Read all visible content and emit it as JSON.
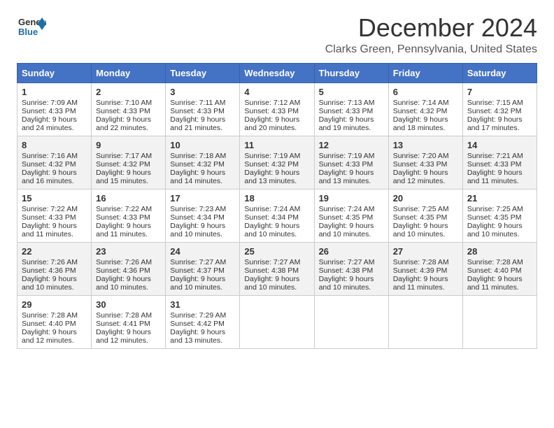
{
  "logo": {
    "general": "General",
    "blue": "Blue"
  },
  "title": "December 2024",
  "location": "Clarks Green, Pennsylvania, United States",
  "days_header": [
    "Sunday",
    "Monday",
    "Tuesday",
    "Wednesday",
    "Thursday",
    "Friday",
    "Saturday"
  ],
  "weeks": [
    [
      {
        "day": "1",
        "sunrise": "Sunrise: 7:09 AM",
        "sunset": "Sunset: 4:33 PM",
        "daylight": "Daylight: 9 hours and 24 minutes."
      },
      {
        "day": "2",
        "sunrise": "Sunrise: 7:10 AM",
        "sunset": "Sunset: 4:33 PM",
        "daylight": "Daylight: 9 hours and 22 minutes."
      },
      {
        "day": "3",
        "sunrise": "Sunrise: 7:11 AM",
        "sunset": "Sunset: 4:33 PM",
        "daylight": "Daylight: 9 hours and 21 minutes."
      },
      {
        "day": "4",
        "sunrise": "Sunrise: 7:12 AM",
        "sunset": "Sunset: 4:33 PM",
        "daylight": "Daylight: 9 hours and 20 minutes."
      },
      {
        "day": "5",
        "sunrise": "Sunrise: 7:13 AM",
        "sunset": "Sunset: 4:33 PM",
        "daylight": "Daylight: 9 hours and 19 minutes."
      },
      {
        "day": "6",
        "sunrise": "Sunrise: 7:14 AM",
        "sunset": "Sunset: 4:32 PM",
        "daylight": "Daylight: 9 hours and 18 minutes."
      },
      {
        "day": "7",
        "sunrise": "Sunrise: 7:15 AM",
        "sunset": "Sunset: 4:32 PM",
        "daylight": "Daylight: 9 hours and 17 minutes."
      }
    ],
    [
      {
        "day": "8",
        "sunrise": "Sunrise: 7:16 AM",
        "sunset": "Sunset: 4:32 PM",
        "daylight": "Daylight: 9 hours and 16 minutes."
      },
      {
        "day": "9",
        "sunrise": "Sunrise: 7:17 AM",
        "sunset": "Sunset: 4:32 PM",
        "daylight": "Daylight: 9 hours and 15 minutes."
      },
      {
        "day": "10",
        "sunrise": "Sunrise: 7:18 AM",
        "sunset": "Sunset: 4:32 PM",
        "daylight": "Daylight: 9 hours and 14 minutes."
      },
      {
        "day": "11",
        "sunrise": "Sunrise: 7:19 AM",
        "sunset": "Sunset: 4:32 PM",
        "daylight": "Daylight: 9 hours and 13 minutes."
      },
      {
        "day": "12",
        "sunrise": "Sunrise: 7:19 AM",
        "sunset": "Sunset: 4:33 PM",
        "daylight": "Daylight: 9 hours and 13 minutes."
      },
      {
        "day": "13",
        "sunrise": "Sunrise: 7:20 AM",
        "sunset": "Sunset: 4:33 PM",
        "daylight": "Daylight: 9 hours and 12 minutes."
      },
      {
        "day": "14",
        "sunrise": "Sunrise: 7:21 AM",
        "sunset": "Sunset: 4:33 PM",
        "daylight": "Daylight: 9 hours and 11 minutes."
      }
    ],
    [
      {
        "day": "15",
        "sunrise": "Sunrise: 7:22 AM",
        "sunset": "Sunset: 4:33 PM",
        "daylight": "Daylight: 9 hours and 11 minutes."
      },
      {
        "day": "16",
        "sunrise": "Sunrise: 7:22 AM",
        "sunset": "Sunset: 4:33 PM",
        "daylight": "Daylight: 9 hours and 11 minutes."
      },
      {
        "day": "17",
        "sunrise": "Sunrise: 7:23 AM",
        "sunset": "Sunset: 4:34 PM",
        "daylight": "Daylight: 9 hours and 10 minutes."
      },
      {
        "day": "18",
        "sunrise": "Sunrise: 7:24 AM",
        "sunset": "Sunset: 4:34 PM",
        "daylight": "Daylight: 9 hours and 10 minutes."
      },
      {
        "day": "19",
        "sunrise": "Sunrise: 7:24 AM",
        "sunset": "Sunset: 4:35 PM",
        "daylight": "Daylight: 9 hours and 10 minutes."
      },
      {
        "day": "20",
        "sunrise": "Sunrise: 7:25 AM",
        "sunset": "Sunset: 4:35 PM",
        "daylight": "Daylight: 9 hours and 10 minutes."
      },
      {
        "day": "21",
        "sunrise": "Sunrise: 7:25 AM",
        "sunset": "Sunset: 4:35 PM",
        "daylight": "Daylight: 9 hours and 10 minutes."
      }
    ],
    [
      {
        "day": "22",
        "sunrise": "Sunrise: 7:26 AM",
        "sunset": "Sunset: 4:36 PM",
        "daylight": "Daylight: 9 hours and 10 minutes."
      },
      {
        "day": "23",
        "sunrise": "Sunrise: 7:26 AM",
        "sunset": "Sunset: 4:36 PM",
        "daylight": "Daylight: 9 hours and 10 minutes."
      },
      {
        "day": "24",
        "sunrise": "Sunrise: 7:27 AM",
        "sunset": "Sunset: 4:37 PM",
        "daylight": "Daylight: 9 hours and 10 minutes."
      },
      {
        "day": "25",
        "sunrise": "Sunrise: 7:27 AM",
        "sunset": "Sunset: 4:38 PM",
        "daylight": "Daylight: 9 hours and 10 minutes."
      },
      {
        "day": "26",
        "sunrise": "Sunrise: 7:27 AM",
        "sunset": "Sunset: 4:38 PM",
        "daylight": "Daylight: 9 hours and 10 minutes."
      },
      {
        "day": "27",
        "sunrise": "Sunrise: 7:28 AM",
        "sunset": "Sunset: 4:39 PM",
        "daylight": "Daylight: 9 hours and 11 minutes."
      },
      {
        "day": "28",
        "sunrise": "Sunrise: 7:28 AM",
        "sunset": "Sunset: 4:40 PM",
        "daylight": "Daylight: 9 hours and 11 minutes."
      }
    ],
    [
      {
        "day": "29",
        "sunrise": "Sunrise: 7:28 AM",
        "sunset": "Sunset: 4:40 PM",
        "daylight": "Daylight: 9 hours and 12 minutes."
      },
      {
        "day": "30",
        "sunrise": "Sunrise: 7:28 AM",
        "sunset": "Sunset: 4:41 PM",
        "daylight": "Daylight: 9 hours and 12 minutes."
      },
      {
        "day": "31",
        "sunrise": "Sunrise: 7:29 AM",
        "sunset": "Sunset: 4:42 PM",
        "daylight": "Daylight: 9 hours and 13 minutes."
      },
      null,
      null,
      null,
      null
    ]
  ]
}
